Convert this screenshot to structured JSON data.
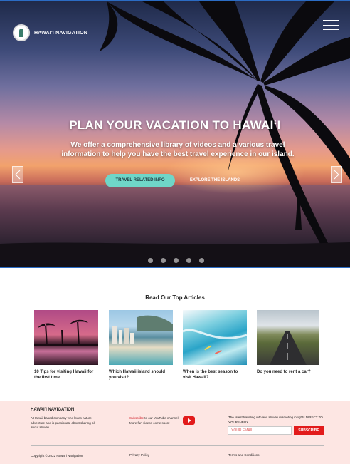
{
  "header": {
    "brand": "HAWAI'I NAVIGATION"
  },
  "hero": {
    "title": "PLAN YOUR VACATION TO HAWAIʻI",
    "subtitle": "We offer a comprehensive library of videos and a various travel information to help you have the best travel experience in our island.",
    "primary_button": "TRAVEL RELATED INFO",
    "secondary_button": "EXPLORE THE ISLANDS",
    "slide_count": 5
  },
  "articles": {
    "title": "Read Our Top Articles",
    "items": [
      {
        "caption": "10 Tips for visiting Hawaii for the first time",
        "image": "sunset-palms-photo"
      },
      {
        "caption": "Which Hawaii island should you visit?",
        "image": "waikiki-beach-photo"
      },
      {
        "caption": "When is the best season to visit Hawaii?",
        "image": "surfers-wave-photo"
      },
      {
        "caption": "Do you need to rent a car?",
        "image": "island-road-photo"
      }
    ]
  },
  "footer": {
    "brand": "HAWAI'I NAVIGATION",
    "about": "A Hawaii based company who loves nature, adventure and is passionate about sharing all about Hawaii.",
    "subscribe_link": "Subscribe",
    "subscribe_text": " to our YouTube channel. More fun videos come soon!",
    "newsletter_text": "The latest traveling info and Hawaii marketing insights DIRECT TO YOUR INBOX",
    "email_placeholder": "YOUR EMAIL",
    "subscribe_button": "SUBSCRIBE",
    "copyright": "Copyright © 2022 Hawai'i Navigation",
    "privacy": "Privacy Policy",
    "terms": "Terms and Conditions"
  },
  "colors": {
    "accent_teal": "#6fd6c8",
    "footer_bg": "#fde6e3",
    "red": "#e21b1b"
  }
}
